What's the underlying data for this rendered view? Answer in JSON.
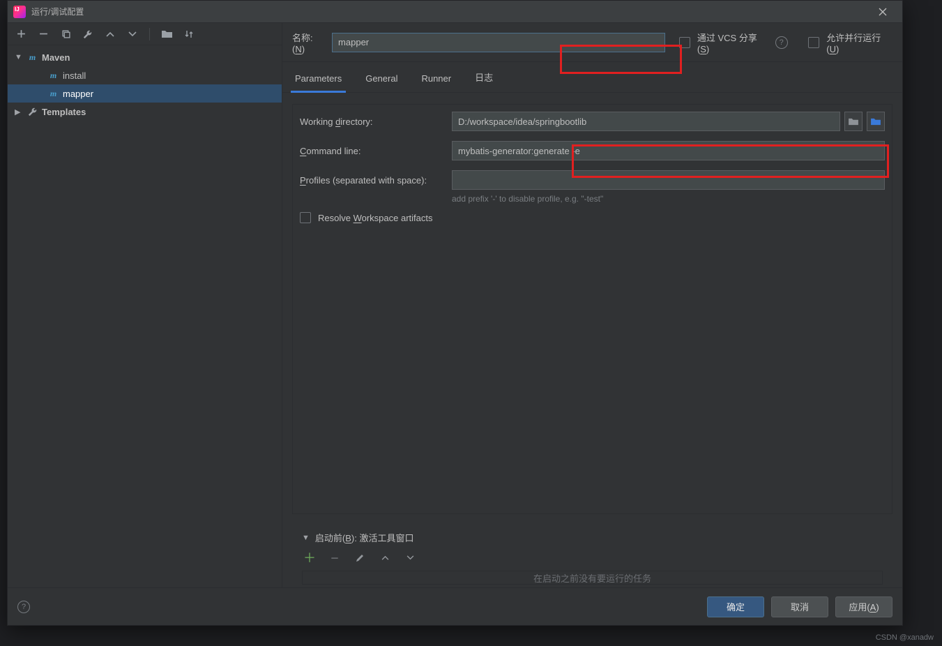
{
  "window": {
    "title": "运行/调试配置"
  },
  "sidebar": {
    "items": [
      {
        "label": "Maven",
        "icon": "m",
        "expanded": true
      },
      {
        "label": "install",
        "icon": "m"
      },
      {
        "label": "mapper",
        "icon": "m",
        "selected": true
      },
      {
        "label": "Templates",
        "icon": "wrench",
        "expanded": false
      }
    ]
  },
  "header": {
    "name_label_pre": "名称:(",
    "name_label_u": "N",
    "name_label_post": ")",
    "name_value": "mapper",
    "share_pre": "通过 VCS 分享(",
    "share_u": "S",
    "share_post": ")",
    "parallel_pre": "允许并行运行(",
    "parallel_u": "U",
    "parallel_post": ")"
  },
  "tabs": [
    {
      "label": "Parameters",
      "active": true
    },
    {
      "label": "General"
    },
    {
      "label": "Runner"
    },
    {
      "label": "日志"
    }
  ],
  "form": {
    "workdir_label_pre": "Working ",
    "workdir_label_u": "d",
    "workdir_label_post": "irectory:",
    "workdir_value": "D:/workspace/idea/springbootlib",
    "cmd_label_u": "C",
    "cmd_label_post": "ommand line:",
    "cmd_value": "mybatis-generator:generate -e",
    "profiles_label_u": "P",
    "profiles_label_post": "rofiles (separated with space):",
    "profiles_value": "",
    "profiles_hint": "add prefix '-' to disable profile, e.g. \"-test\"",
    "resolve_label_pre": "Resolve ",
    "resolve_label_u": "W",
    "resolve_label_post": "orkspace artifacts"
  },
  "before": {
    "header_pre": "启动前(",
    "header_u": "B",
    "header_post": "): 激活工具窗口",
    "empty_text": "在启动之前没有要运行的任务"
  },
  "footer": {
    "ok": "确定",
    "cancel": "取消",
    "apply_pre": "应用(",
    "apply_u": "A",
    "apply_post": ")"
  },
  "watermark": "CSDN @xanadw"
}
